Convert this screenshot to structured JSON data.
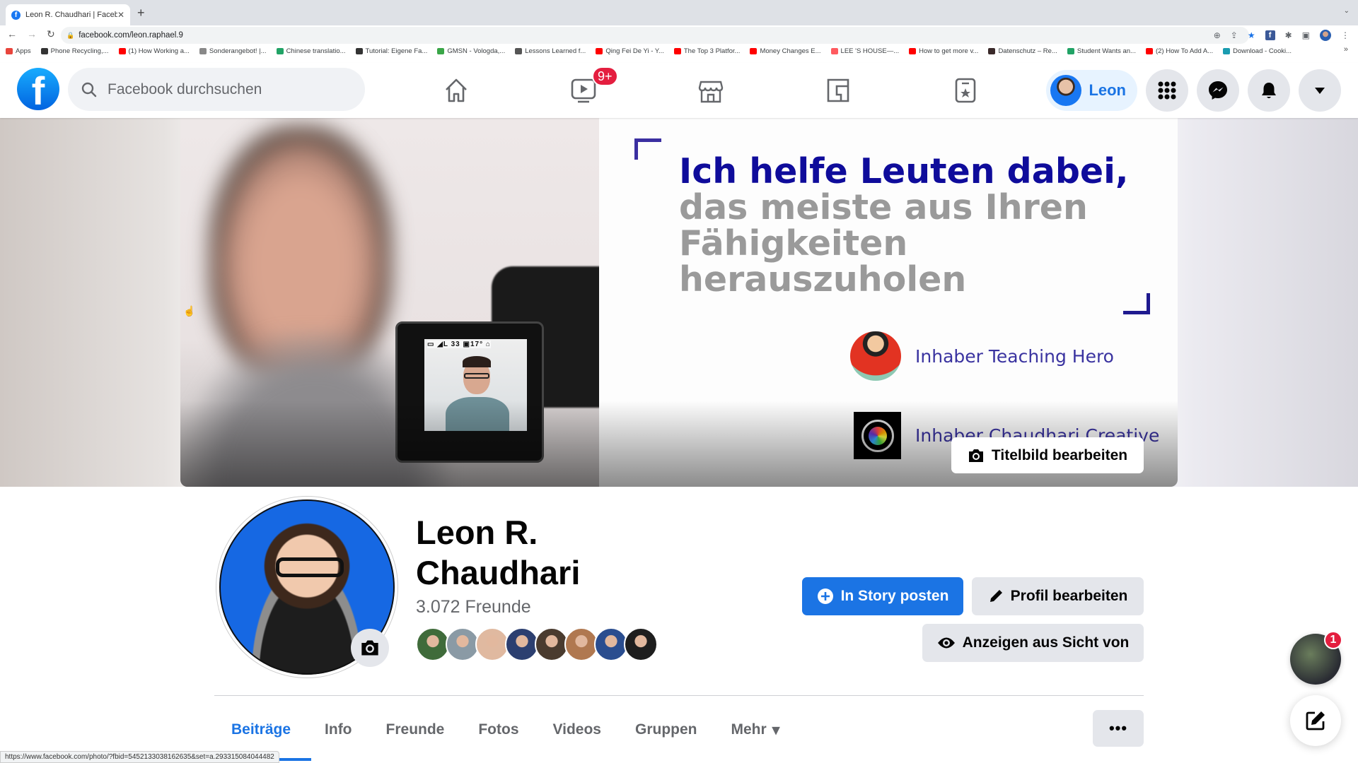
{
  "browser": {
    "tab_title": "Leon R. Chaudhari | Facebook",
    "url": "facebook.com/leon.raphael.9",
    "bookmarks": [
      {
        "label": "Apps",
        "color": "#e8453c"
      },
      {
        "label": "Phone Recycling,...",
        "color": "#333333"
      },
      {
        "label": "(1) How Working a...",
        "color": "#ff0000"
      },
      {
        "label": "Sonderangebot! |...",
        "color": "#888888"
      },
      {
        "label": "Chinese translatio...",
        "color": "#21a366"
      },
      {
        "label": "Tutorial: Eigene Fa...",
        "color": "#333333"
      },
      {
        "label": "GMSN - Vologda,...",
        "color": "#3aa648"
      },
      {
        "label": "Lessons Learned f...",
        "color": "#555555"
      },
      {
        "label": "Qing Fei De Yi - Y...",
        "color": "#ff0000"
      },
      {
        "label": "The Top 3 Platfor...",
        "color": "#ff0000"
      },
      {
        "label": "Money Changes E...",
        "color": "#ff0000"
      },
      {
        "label": "LEE 'S HOUSE—...",
        "color": "#ff5a5f"
      },
      {
        "label": "How to get more v...",
        "color": "#ff0000"
      },
      {
        "label": "Datenschutz – Re...",
        "color": "#3a2a2a"
      },
      {
        "label": "Student Wants an...",
        "color": "#21a366"
      },
      {
        "label": "(2) How To Add A...",
        "color": "#ff0000"
      },
      {
        "label": "Download - Cooki...",
        "color": "#1a9cb0"
      }
    ],
    "bookmarks_overflow": "»",
    "status_url": "https://www.facebook.com/photo/?fbid=5452133038162635&set=a.293315084044482"
  },
  "header": {
    "logo": "f",
    "search_placeholder": "Facebook durchsuchen",
    "watch_badge": "9+",
    "user_name": "Leon"
  },
  "cover": {
    "headline_line1": "Ich helfe Leuten dabei,",
    "headline_rest": "das meiste aus Ihren\nFähigkeiten\nherauszuholen",
    "owner1": "Inhaber Teaching Hero",
    "owner2": "Inhaber Chaudhari Creative",
    "lcd_hud": "▭ ◢L 33  ▣17°    ⌂",
    "edit_cover_label": "Titelbild bearbeiten"
  },
  "profile": {
    "name": "Leon R. Chaudhari",
    "friends_count": "3.072 Freunde",
    "friend_avatars": [
      "#3f6b3a",
      "#8a9aa5",
      "#e0b9a0",
      "#2c3f70",
      "#4a3b2f",
      "#b07850",
      "#2a4d8f",
      "#1e1e1e"
    ],
    "actions": {
      "story": "In Story posten",
      "edit_profile": "Profil bearbeiten",
      "view_as": "Anzeigen aus Sicht von"
    },
    "tabs": [
      "Beiträge",
      "Info",
      "Freunde",
      "Fotos",
      "Videos",
      "Gruppen",
      "Mehr"
    ],
    "active_tab": "Beiträge",
    "more_button": "•••"
  },
  "chat": {
    "unread_badge": "1"
  },
  "colors": {
    "brand": "#1877f2",
    "accent": "#1b74e4",
    "badge": "#e41e3f"
  }
}
